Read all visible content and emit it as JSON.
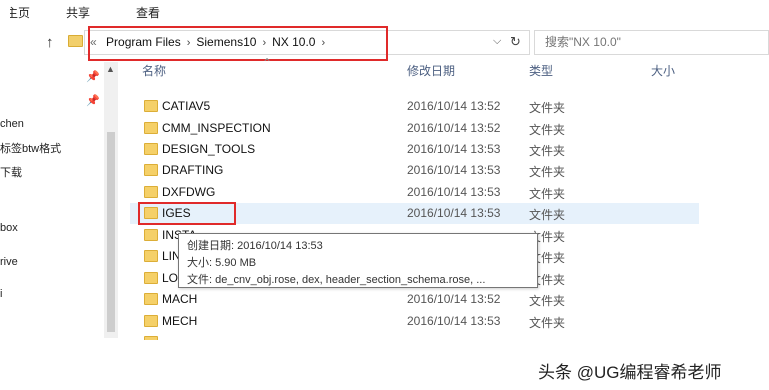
{
  "ribbon": {
    "tabs": [
      "主页",
      "共享",
      "查看"
    ]
  },
  "address": {
    "overflow": "«",
    "crumbs": [
      "Program Files",
      "Siemens10",
      "NX 10.0"
    ],
    "dropdown_icon": "chevron-down",
    "refresh_icon": "refresh"
  },
  "search": {
    "placeholder": "搜索\"NX 10.0\""
  },
  "nav": {
    "items": [
      "chen",
      "标签btw格式",
      "下载",
      "box",
      "rive",
      "i"
    ]
  },
  "columns": {
    "name": "名称",
    "date": "修改日期",
    "type": "类型",
    "size": "大小"
  },
  "files": [
    {
      "name": "CATIAV5",
      "date": "2016/10/14 13:52",
      "type": "文件夹"
    },
    {
      "name": "CMM_INSPECTION",
      "date": "2016/10/14 13:52",
      "type": "文件夹"
    },
    {
      "name": "DESIGN_TOOLS",
      "date": "2016/10/14 13:53",
      "type": "文件夹"
    },
    {
      "name": "DRAFTING",
      "date": "2016/10/14 13:53",
      "type": "文件夹"
    },
    {
      "name": "DXFDWG",
      "date": "2016/10/14 13:53",
      "type": "文件夹"
    },
    {
      "name": "IGES",
      "date": "2016/10/14 13:53",
      "type": "文件夹"
    },
    {
      "name": "INSTA",
      "date": "",
      "type": "文件夹"
    },
    {
      "name": "LIN",
      "date": "",
      "type": "文件夹"
    },
    {
      "name": "LO",
      "date": "",
      "type": "文件夹"
    },
    {
      "name": "MACH",
      "date": "2016/10/14 13:52",
      "type": "文件夹"
    },
    {
      "name": "MECH",
      "date": "2016/10/14 13:53",
      "type": "文件夹"
    }
  ],
  "tooltip": {
    "created": "创建日期: 2016/10/14 13:53",
    "size": "大小: 5.90 MB",
    "files": "文件: de_cnv_obj.rose, dex, header_section_schema.rose, ..."
  },
  "watermark": "头条 @UG编程睿希老师",
  "colors": {
    "highlight": "#e02a2a",
    "selected_row": "#e6f1fb",
    "header_text": "#4d6082"
  }
}
